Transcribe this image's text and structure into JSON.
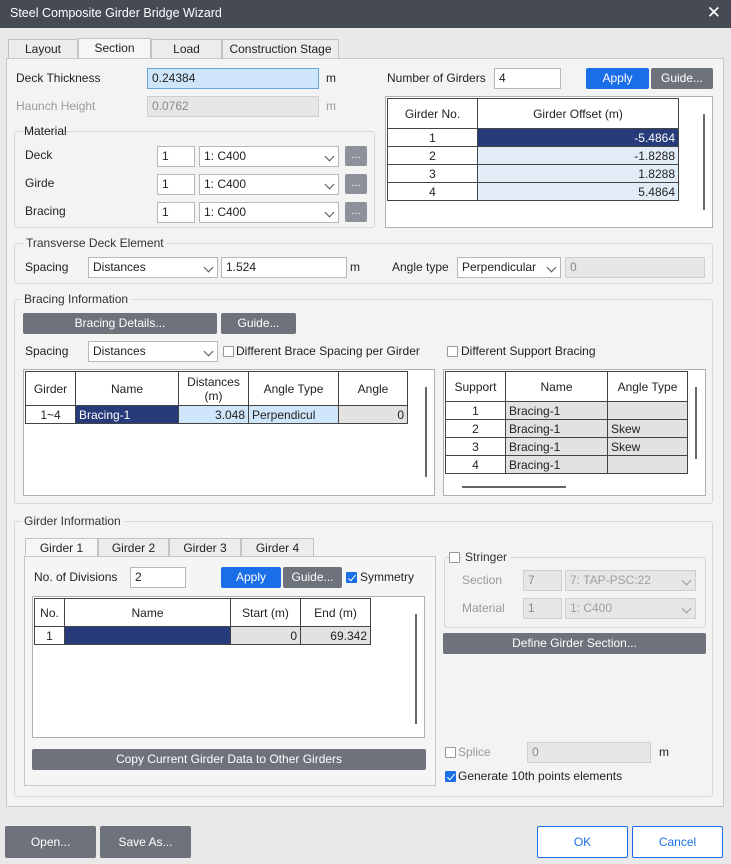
{
  "window": {
    "title": "Steel Composite Girder Bridge Wizard",
    "close": "✕"
  },
  "tabs": [
    "Layout",
    "Section",
    "Load",
    "Construction Stage"
  ],
  "deck": {
    "thickness_label": "Deck Thickness",
    "thickness_value": "0.24384",
    "thickness_unit": "m",
    "haunch_label": "Haunch Height",
    "haunch_value": "0.0762",
    "haunch_unit": "m"
  },
  "material": {
    "title": "Material",
    "rows": [
      {
        "label": "Deck",
        "num": "1",
        "mat": "1: C400",
        "btn": "..."
      },
      {
        "label": "Girde",
        "num": "1",
        "mat": "1: C400",
        "btn": "..."
      },
      {
        "label": "Bracing",
        "num": "1",
        "mat": "1: C400",
        "btn": "..."
      }
    ]
  },
  "girders": {
    "label": "Number of Girders",
    "value": "4",
    "apply": "Apply",
    "guide": "Guide...",
    "headers": [
      "Girder No.",
      "Girder Offset (m)"
    ],
    "rows": [
      [
        "1",
        "-5.4864"
      ],
      [
        "2",
        "-1.8288"
      ],
      [
        "3",
        "1.8288"
      ],
      [
        "4",
        "5.4864"
      ]
    ]
  },
  "transverse": {
    "title": "Transverse Deck Element",
    "spacing_label": "Spacing",
    "spacing_type": "Distances",
    "spacing_value": "1.524",
    "unit": "m",
    "angle_label": "Angle type",
    "angle_type": "Perpendicular",
    "angle_value": "0"
  },
  "bracing": {
    "title": "Bracing Information",
    "details_btn": "Bracing Details...",
    "guide_btn": "Guide...",
    "spacing_label": "Spacing",
    "spacing_type": "Distances",
    "diff_spacing": "Different Brace Spacing per Girder",
    "diff_support": "Different Support Bracing",
    "headers": [
      "Girder",
      "Name",
      "Distances\n(m)",
      "Angle Type",
      "Angle"
    ],
    "rows": [
      [
        "1~4",
        "Bracing-1",
        "3.048",
        "Perpendicul",
        "0"
      ]
    ],
    "support_headers": [
      "Support",
      "Name",
      "Angle Type"
    ],
    "support_rows": [
      [
        "1",
        "Bracing-1",
        ""
      ],
      [
        "2",
        "Bracing-1",
        "Skew"
      ],
      [
        "3",
        "Bracing-1",
        "Skew"
      ],
      [
        "4",
        "Bracing-1",
        ""
      ]
    ]
  },
  "girder_info": {
    "title": "Girder Information",
    "tabs": [
      "Girder 1",
      "Girder 2",
      "Girder 3",
      "Girder 4"
    ],
    "div_label": "No. of Divisions",
    "div_value": "2",
    "apply": "Apply",
    "guide": "Guide...",
    "symmetry": "Symmetry",
    "headers": [
      "No.",
      "Name",
      "Start (m)",
      "End (m)"
    ],
    "rows": [
      [
        "1",
        "",
        "0",
        "69.342"
      ]
    ],
    "copy_btn": "Copy Current Girder Data to Other Girders"
  },
  "stringer": {
    "label": "Stringer",
    "section_label": "Section",
    "section_num": "7",
    "section_val": "7: TAP-PSC:22",
    "material_label": "Material",
    "material_num": "1",
    "material_val": "1: C400",
    "define_btn": "Define Girder Section..."
  },
  "splice": {
    "label": "Splice",
    "value": "0",
    "unit": "m",
    "gen10": "Generate 10th points elements"
  },
  "footer": {
    "open": "Open...",
    "saveas": "Save As...",
    "ok": "OK",
    "cancel": "Cancel"
  },
  "colors": {
    "titlebar": "#454a55",
    "accent": "#1a6fe8",
    "selected": "#273a7a"
  }
}
